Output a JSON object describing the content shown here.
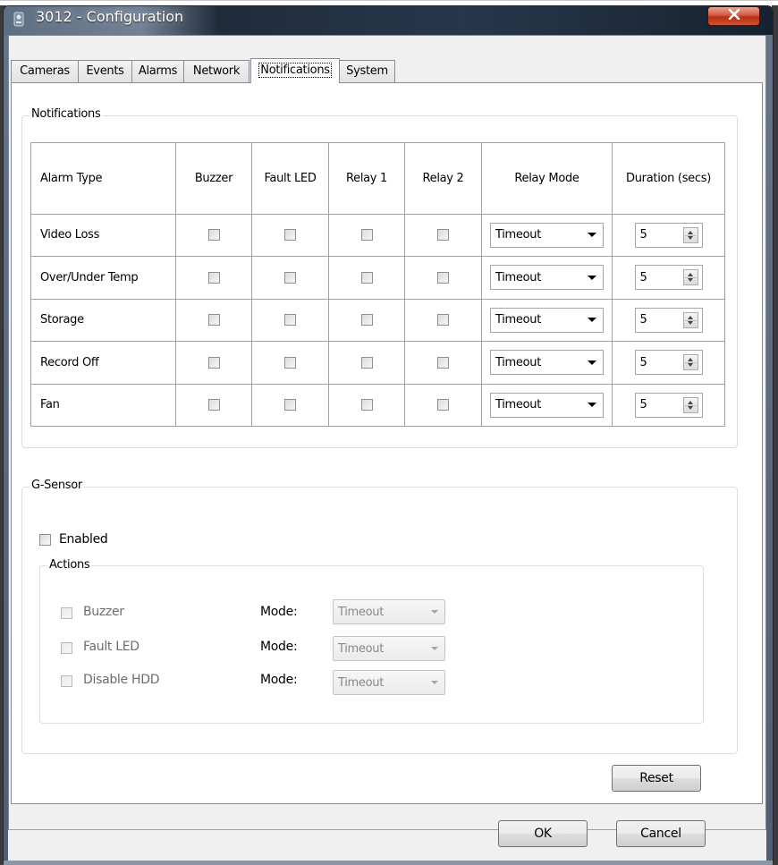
{
  "window": {
    "title": "3012 - Configuration"
  },
  "tabs": [
    {
      "label": "Cameras",
      "active": false
    },
    {
      "label": "Events",
      "active": false
    },
    {
      "label": "Alarms",
      "active": false
    },
    {
      "label": "Network",
      "active": false
    },
    {
      "label": "Notifications",
      "active": true
    },
    {
      "label": "System",
      "active": false
    }
  ],
  "notifications": {
    "group_label": "Notifications",
    "columns": [
      "Alarm Type",
      "Buzzer",
      "Fault LED",
      "Relay 1",
      "Relay 2",
      "Relay Mode",
      "Duration (secs)"
    ],
    "rows": [
      {
        "alarm_type": "Video Loss",
        "buzzer": false,
        "fault_led": false,
        "relay1": false,
        "relay2": false,
        "relay_mode": "Timeout",
        "duration": "5"
      },
      {
        "alarm_type": "Over/Under Temp",
        "buzzer": false,
        "fault_led": false,
        "relay1": false,
        "relay2": false,
        "relay_mode": "Timeout",
        "duration": "5"
      },
      {
        "alarm_type": "Storage",
        "buzzer": false,
        "fault_led": false,
        "relay1": false,
        "relay2": false,
        "relay_mode": "Timeout",
        "duration": "5"
      },
      {
        "alarm_type": "Record Off",
        "buzzer": false,
        "fault_led": false,
        "relay1": false,
        "relay2": false,
        "relay_mode": "Timeout",
        "duration": "5"
      },
      {
        "alarm_type": "Fan",
        "buzzer": false,
        "fault_led": false,
        "relay1": false,
        "relay2": false,
        "relay_mode": "Timeout",
        "duration": "5"
      }
    ]
  },
  "gsensor": {
    "group_label": "G-Sensor",
    "enabled_label": "Enabled",
    "enabled": false,
    "actions_label": "Actions",
    "mode_label": "Mode:",
    "actions": [
      {
        "label": "Buzzer",
        "checked": false,
        "mode": "Timeout"
      },
      {
        "label": "Fault LED",
        "checked": false,
        "mode": "Timeout"
      },
      {
        "label": "Disable HDD",
        "checked": false,
        "mode": "Timeout"
      }
    ]
  },
  "buttons": {
    "reset": "Reset",
    "ok": "OK",
    "cancel": "Cancel"
  },
  "colors": {
    "close_button": "#c9462a",
    "titlebar": "#27374b",
    "dialog_bg": "#f0f0f0"
  },
  "icons": {
    "app": "camera-app-icon",
    "close": "close-icon",
    "dropdown": "chevron-down-icon",
    "spinner": "up-down-arrows-icon"
  }
}
